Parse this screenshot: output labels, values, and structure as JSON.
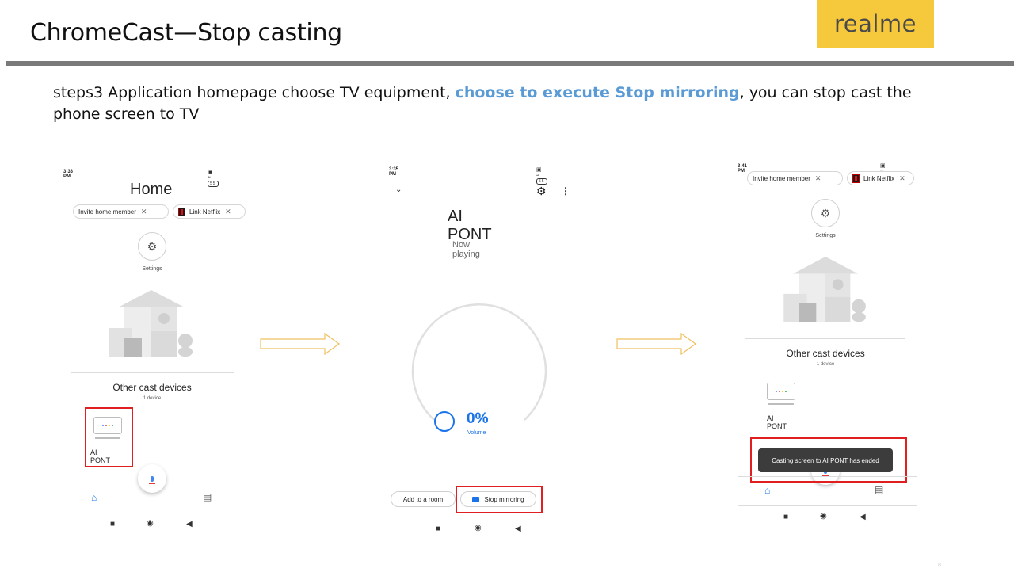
{
  "slide": {
    "title": "ChromeCast—Stop casting",
    "brand": "realme",
    "step": {
      "prefix": "steps3  Application homepage choose TV equipment, ",
      "highlight": "choose to execute Stop mirroring",
      "suffix": ", you can stop cast the phone screen to TV"
    },
    "page_number": "8"
  },
  "screen1": {
    "time": "3:33 PM",
    "battery": "55",
    "title": "Home",
    "chips": {
      "invite": "Invite home member",
      "netflix": "Link Netflix"
    },
    "settings_label": "Settings",
    "other_devices_title": "Other cast devices",
    "device_count": "1 device",
    "device_name": "AI PONT"
  },
  "screen2": {
    "time": "3:35 PM",
    "battery": "55",
    "device_title": "AI PONT",
    "now_playing": "Now playing",
    "volume_percent": "0%",
    "volume_value": 0,
    "volume_label": "Volume",
    "add_room": "Add to a room",
    "stop_mirroring": "Stop mirroring"
  },
  "screen3": {
    "time": "3:41 PM",
    "battery": "55",
    "chips": {
      "invite": "Invite home member",
      "netflix": "Link Netflix"
    },
    "settings_label": "Settings",
    "other_devices_title": "Other cast devices",
    "device_count": "1 device",
    "device_name": "AI PONT",
    "toast": "Casting screen to AI PONT has ended"
  },
  "icons": {
    "gear": "gear-icon",
    "close": "close-icon",
    "home": "home-icon",
    "feed": "feed-icon",
    "mic": "mic-icon",
    "square": "recents-icon",
    "circle": "home-button-icon",
    "back": "back-icon",
    "chevron": "chevron-down-icon",
    "more": "more-vert-icon"
  },
  "colors": {
    "brand_bg": "#f6c83c",
    "highlight": "#5b9bd5",
    "accent_blue": "#1a73e8",
    "red_box": "#e02020",
    "arrow": "#f0c060"
  }
}
